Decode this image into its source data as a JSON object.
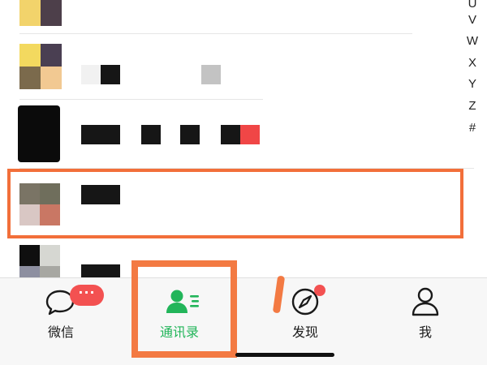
{
  "index_bar": {
    "letters": [
      "U",
      "V",
      "W",
      "X",
      "Y",
      "Z",
      "#"
    ]
  },
  "contacts": [
    {
      "name": "",
      "censored": true
    },
    {
      "name": "",
      "censored": true
    },
    {
      "name": "",
      "censored": true
    },
    {
      "name": "",
      "censored": true,
      "highlighted": true
    },
    {
      "name": "",
      "censored": true
    }
  ],
  "tabs": [
    {
      "label": "微信",
      "icon": "chat-bubble-icon",
      "badge": "···",
      "active": false
    },
    {
      "label": "通讯录",
      "icon": "contacts-icon",
      "active": true
    },
    {
      "label": "发现",
      "icon": "compass-icon",
      "dot": true,
      "active": false
    },
    {
      "label": "我",
      "icon": "person-icon",
      "active": false
    }
  ],
  "colors": {
    "accent_green": "#22b55a",
    "badge_red": "#f35151",
    "annotation_orange": "#f37a43"
  }
}
